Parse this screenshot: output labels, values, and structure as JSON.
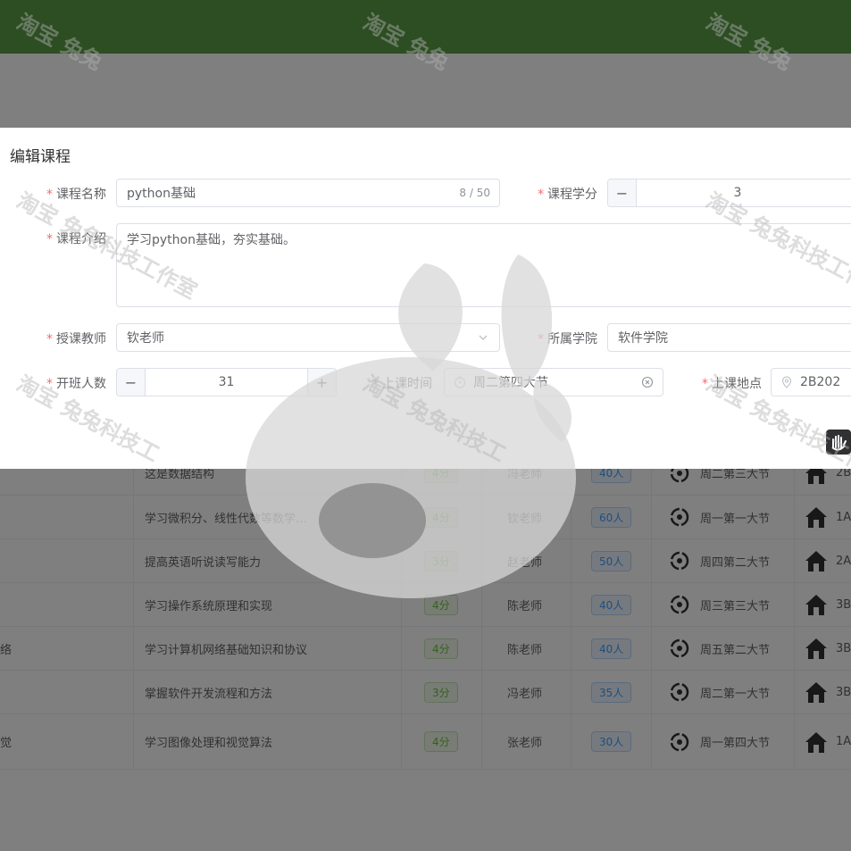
{
  "dialog": {
    "title": "编辑课程",
    "fields": {
      "name": {
        "label": "课程名称",
        "value": "python基础",
        "counter": "8 / 50"
      },
      "credit": {
        "label": "课程学分",
        "value": "3"
      },
      "intro": {
        "label": "课程介绍",
        "value": "学习python基础，夯实基础。"
      },
      "teacher": {
        "label": "授课教师",
        "value": "钦老师"
      },
      "college": {
        "label": "所属学院",
        "value": "软件学院"
      },
      "capacity": {
        "label": "开班人数",
        "value": "31",
        "decrease": "−",
        "increase": "+"
      },
      "time": {
        "label": "上课时间",
        "value": "周二第四大节"
      },
      "place": {
        "label": "上课地点",
        "value": "2B202"
      }
    }
  },
  "table": {
    "rows": [
      {
        "name": "",
        "desc": "这是数据结构",
        "credit": "4分",
        "teacher": "冯老师",
        "count": "40人",
        "time": "周二第三大节",
        "place": "2B"
      },
      {
        "name": "",
        "desc": "学习微积分、线性代数等数学…",
        "credit": "4分",
        "teacher": "钦老师",
        "count": "60人",
        "time": "周一第一大节",
        "place": "1A"
      },
      {
        "name": "",
        "desc": "提高英语听说读写能力",
        "credit": "3分",
        "teacher": "赵老师",
        "count": "50人",
        "time": "周四第二大节",
        "place": "2A"
      },
      {
        "name": "",
        "desc": "学习操作系统原理和实现",
        "credit": "4分",
        "teacher": "陈老师",
        "count": "40人",
        "time": "周三第三大节",
        "place": "3B"
      },
      {
        "name": "络",
        "desc": "学习计算机网络基础知识和协议",
        "credit": "4分",
        "teacher": "陈老师",
        "count": "40人",
        "time": "周五第二大节",
        "place": "3B"
      },
      {
        "name": "",
        "desc": "掌握软件开发流程和方法",
        "credit": "3分",
        "teacher": "冯老师",
        "count": "35人",
        "time": "周二第一大节",
        "place": "3B"
      },
      {
        "name": "觉",
        "desc": "学习图像处理和视觉算法",
        "credit": "4分",
        "teacher": "张老师",
        "count": "30人",
        "time": "周一第四大节",
        "place": "1A"
      }
    ]
  },
  "watermark": {
    "text_a": "淘宝 兔兔科技工作室",
    "text_b": "淘宝 兔兔",
    "text_c": "淘宝 兔兔科技工"
  },
  "colors": {
    "header_green": "#5b9a47",
    "required_red": "#f56c6c",
    "overlay": "rgba(0,0,0,0.5)"
  },
  "icons": {
    "clock": "clock-icon",
    "house": "house-icon",
    "location": "location-pin-icon",
    "select_arrow": "chevron-down-icon",
    "clear": "clear-circle-icon"
  }
}
